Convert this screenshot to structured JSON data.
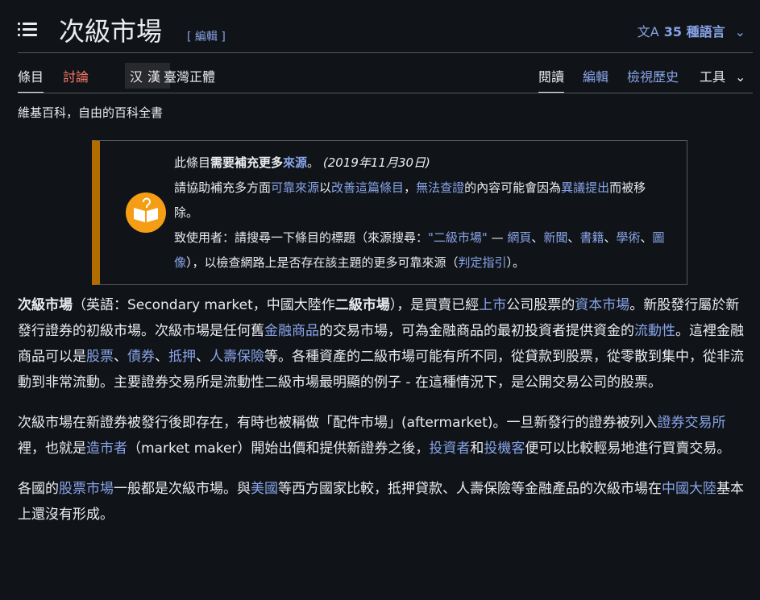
{
  "header": {
    "title": "次級市場",
    "edit_label": "[ 編輯 ]",
    "lang_icon": "translate-icon",
    "lang_label": "35 種語言",
    "lang_chevron": "⌄"
  },
  "tabs": {
    "article": "條目",
    "talk": "討論",
    "variant_1": "汉",
    "variant_2": "漢",
    "variant_name": "臺灣正體",
    "read": "閱讀",
    "edit": "編輯",
    "history": "檢視歷史",
    "tools": "工具",
    "tools_chevron": "⌄"
  },
  "tagline": "維基百科，自由的百科全書",
  "ambox": {
    "l1a": "此條目",
    "l1b": "需要補充更多",
    "l1c": "來源",
    "l1d": "。",
    "date": "(2019年11月30日)",
    "l2a": "請協助補充多方面",
    "l2b": "可靠來源",
    "l2c": "以",
    "l2d": "改善這篇條目",
    "l2e": "，",
    "l2f": "無法查證",
    "l2g": "的內容可能會因為",
    "l2h": "異議提出",
    "l2i": "而被移除。",
    "l3a": "致使用者：請搜尋一下條目的標題（來源搜尋：",
    "l3b": "\"二級市場\"",
    "l3c": " — ",
    "l3d": "網頁",
    "l3e": "、",
    "l3f": "新聞",
    "l3g": "、",
    "l3h": "書籍",
    "l3i": "、",
    "l3j": "學術",
    "l3k": "、",
    "l3l": "圖像",
    "l3m": "），以檢查網路上是否存在該主題的更多可靠來源（",
    "l3n": "判定指引",
    "l3o": "）。"
  },
  "p1": {
    "a": "次級市場",
    "b": "（英語：Secondary market，中國大陸作",
    "c": "二級市場",
    "d": "），是買賣已經",
    "e": "上市",
    "f": "公司股票的",
    "g": "資本市場",
    "h": "。新股發行屬於新發行證券的初級市場。次級市場是任何舊",
    "i": "金融商品",
    "j": "的交易市場，可為金融商品的最初投資者提供資金的",
    "k": "流動性",
    "l": "。這裡金融商品可以是",
    "m": "股票",
    "n": "、",
    "o": "債券",
    "p": "、",
    "q": "抵押",
    "r": "、",
    "s": "人壽保險",
    "t": "等。各種資產的二級市場可能有所不同，從貸款到股票，從零散到集中，從非流動到非常流動。主要證券交易所是流動性二級市場最明顯的例子 - 在這種情況下，是公開交易公司的股票。"
  },
  "p2": {
    "a": "次級市場在新證券被發行後即存在，有時也被稱做「配件市場」(aftermarket)。一旦新發行的證券被列入",
    "b": "證券交易所",
    "c": "裡，也就是",
    "d": "造市者",
    "e": "（market maker）開始出價和提供新證券之後，",
    "f": "投資者",
    "g": "和",
    "h": "投機客",
    "i": "便可以比較輕易地進行買賣交易。"
  },
  "p3": {
    "a": "各國的",
    "b": "股票市場",
    "c": "一般都是次級市場。與",
    "d": "美國",
    "e": "等西方國家比較，抵押貸款、人壽保險等金融產品的次級市場在",
    "f": "中國大陸",
    "g": "基本上還沒有形成。"
  }
}
